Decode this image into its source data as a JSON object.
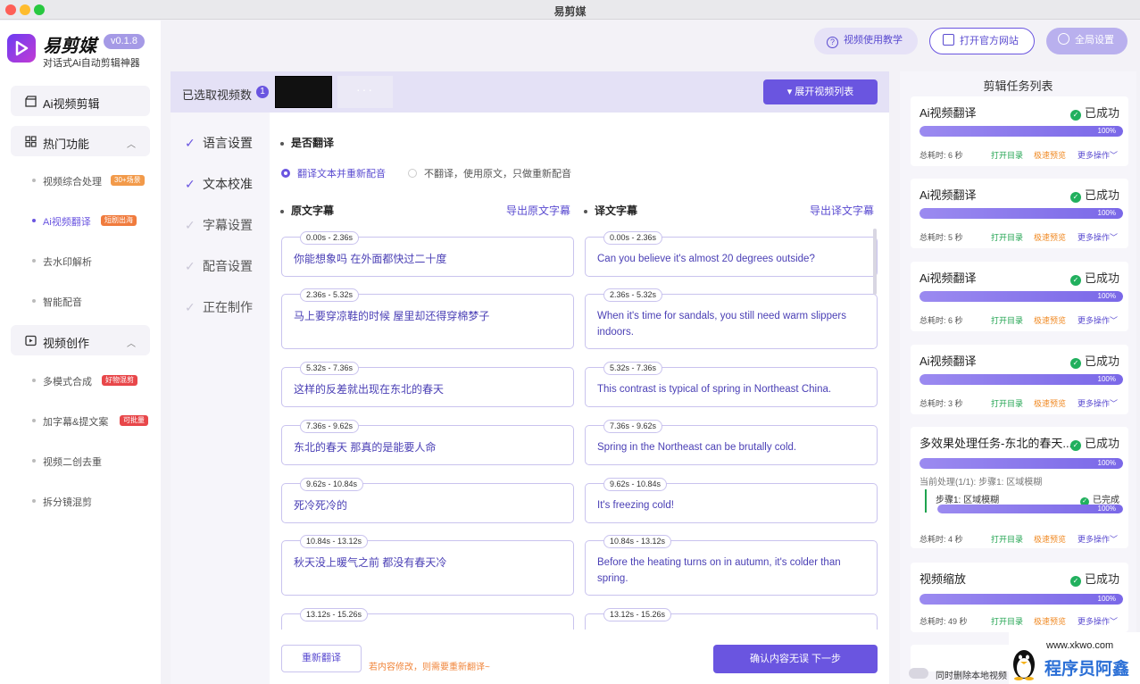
{
  "window": {
    "title": "易剪媒"
  },
  "app": {
    "brand": "易剪媒",
    "version": "v0.1.8",
    "slogan": "对话式Ai自动剪辑神器"
  },
  "nav": {
    "top_item": "Ai视频剪辑",
    "group1": {
      "label": "热门功能",
      "items": [
        {
          "label": "视频综合处理",
          "tag": "30+场景",
          "tag_color": "#f29a4a"
        },
        {
          "label": "Ai视频翻译",
          "tag": "短剧出海",
          "tag_color": "#f07b3d",
          "active": true
        },
        {
          "label": "去水印解析"
        },
        {
          "label": "智能配音"
        }
      ]
    },
    "group2": {
      "label": "视频创作",
      "items": [
        {
          "label": "多模式合成",
          "tag": "好物混剪",
          "tag_color": "#e8474a"
        },
        {
          "label": "加字幕&提文案",
          "tag": "可批量",
          "tag_color": "#e8474a"
        },
        {
          "label": "视频二创去重"
        },
        {
          "label": "拆分镜混剪"
        }
      ]
    }
  },
  "header": {
    "tutorial": "视频使用教学",
    "official": "打开官方网站",
    "settings": "全局设置"
  },
  "topbar": {
    "selected_label": "已选取视频数",
    "selected_count": "1",
    "thumb_more": "···",
    "expand_button": "展开视频列表"
  },
  "steps": [
    {
      "label": "语言设置",
      "done": true
    },
    {
      "label": "文本校准",
      "done": true
    },
    {
      "label": "字幕设置",
      "done": false
    },
    {
      "label": "配音设置",
      "done": false
    },
    {
      "label": "正在制作",
      "done": false
    }
  ],
  "translate": {
    "question": "是否翻译",
    "option_yes": "翻译文本并重新配音",
    "option_no": "不翻译，使用原文，只做重新配音"
  },
  "subtitles": {
    "source_title": "原文字幕",
    "source_export": "导出原文字幕",
    "target_title": "译文字幕",
    "target_export": "导出译文字幕",
    "rows": [
      {
        "time": "0.00s - 2.36s",
        "source": "你能想象吗 在外面都快过二十度",
        "target": "Can you believe it's almost 20 degrees outside?"
      },
      {
        "time": "2.36s - 5.32s",
        "source": "马上要穿凉鞋的时候 屋里却还得穿棉梦子",
        "target": "When it's time for sandals, you still need warm slippers indoors."
      },
      {
        "time": "5.32s - 7.36s",
        "source": "这样的反差就出现在东北的春天",
        "target": "This contrast is typical of spring in Northeast China."
      },
      {
        "time": "7.36s - 9.62s",
        "source": "东北的春天 那真的是能要人命",
        "target": "Spring in the Northeast can be brutally cold."
      },
      {
        "time": "9.62s - 10.84s",
        "source": "死冷死冷的",
        "target": "It's freezing cold!"
      },
      {
        "time": "10.84s - 13.12s",
        "source": "秋天没上暖气之前 都没有春天冷",
        "target": "Before the heating turns on in autumn, it's colder than spring."
      },
      {
        "time": "13.12s - 15.26s",
        "source": "",
        "target": ""
      }
    ]
  },
  "footer": {
    "retranslate": "重新翻译",
    "hint": "若内容修改，则需要重新翻译~",
    "confirm": "确认内容无误 下一步"
  },
  "tasks": {
    "title": "剪辑任务列表",
    "labels": {
      "open": "打开目录",
      "fast": "极速预览",
      "more": "更多操作"
    },
    "items": [
      {
        "name": "Ai视频翻译",
        "status": "已成功",
        "progress": "100%",
        "elapsed": "总耗时: 6 秒"
      },
      {
        "name": "Ai视频翻译",
        "status": "已成功",
        "progress": "100%",
        "elapsed": "总耗时: 5 秒"
      },
      {
        "name": "Ai视频翻译",
        "status": "已成功",
        "progress": "100%",
        "elapsed": "总耗时: 6 秒"
      },
      {
        "name": "Ai视频翻译",
        "status": "已成功",
        "progress": "100%",
        "elapsed": "总耗时: 3 秒"
      },
      {
        "name": "多效果处理任务-东北的春天...",
        "status": "已成功",
        "progress": "100%",
        "elapsed": "总耗时: 4 秒",
        "process_line": "当前处理(1/1): 步骤1:  区域模糊",
        "step_label": "步骤1:  区域模糊",
        "step_status": "已完成",
        "step_progress": "100%"
      },
      {
        "name": "视频缩放",
        "status": "已成功",
        "progress": "100%",
        "elapsed": "总耗时: 49 秒"
      }
    ],
    "delete_label": "同时删除本地视频"
  },
  "watermark": {
    "site": "www.xkwo.com",
    "name": "程序员阿鑫"
  },
  "colors": {
    "accent": "#6a55e0",
    "success": "#21b05e",
    "warning": "#f08a24"
  }
}
